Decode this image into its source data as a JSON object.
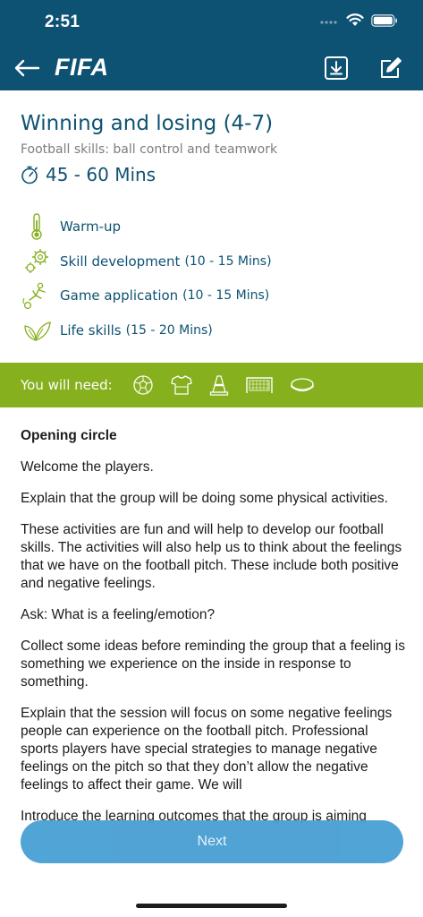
{
  "status_bar": {
    "time": "2:51"
  },
  "nav": {
    "logo": "FIFA"
  },
  "session": {
    "title": "Winning and losing (4-7)",
    "subtitle": "Football skills: ball control and teamwork",
    "duration": "45 - 60 Mins"
  },
  "phases": [
    {
      "label": "Warm-up",
      "time": "",
      "icon": "thermometer-icon"
    },
    {
      "label": "Skill development",
      "time": "(10 - 15 Mins)",
      "icon": "gears-icon"
    },
    {
      "label": "Game application",
      "time": "(10 - 15 Mins)",
      "icon": "player-kick-icon"
    },
    {
      "label": "Life skills",
      "time": "(15 - 20 Mins)",
      "icon": "leaves-icon"
    }
  ],
  "equipment": {
    "label": "You will need:",
    "items": [
      "football-icon",
      "shirt-icon",
      "cone-icon",
      "goal-icon",
      "marker-disc-icon"
    ]
  },
  "body": {
    "heading": "Opening circle",
    "paragraphs": [
      "Welcome the players.",
      "Explain that the group will be doing some physical activities.",
      "These activities are fun and will help to develop our football skills. The activities will also help us to think about the feelings that we have on the football pitch. These include both positive and negative feelings.",
      "Ask: What is a feeling/emotion?",
      "Collect some ideas before reminding the group that a feeling is something we experience on the inside in response to something.",
      "Explain that the session will focus on some negative feelings people can experience on the football pitch. Professional sports players have special strategies to manage negative feelings on the pitch so that they don’t allow the negative feelings to affect their game. We will",
      "Introduce the learning outcomes that the group is aiming"
    ]
  },
  "actions": {
    "next_label": "Next"
  },
  "colors": {
    "header": "#0e5273",
    "accent_green": "#86b01d",
    "button_blue": "#4aa0d4",
    "title_blue": "#0e5273"
  }
}
